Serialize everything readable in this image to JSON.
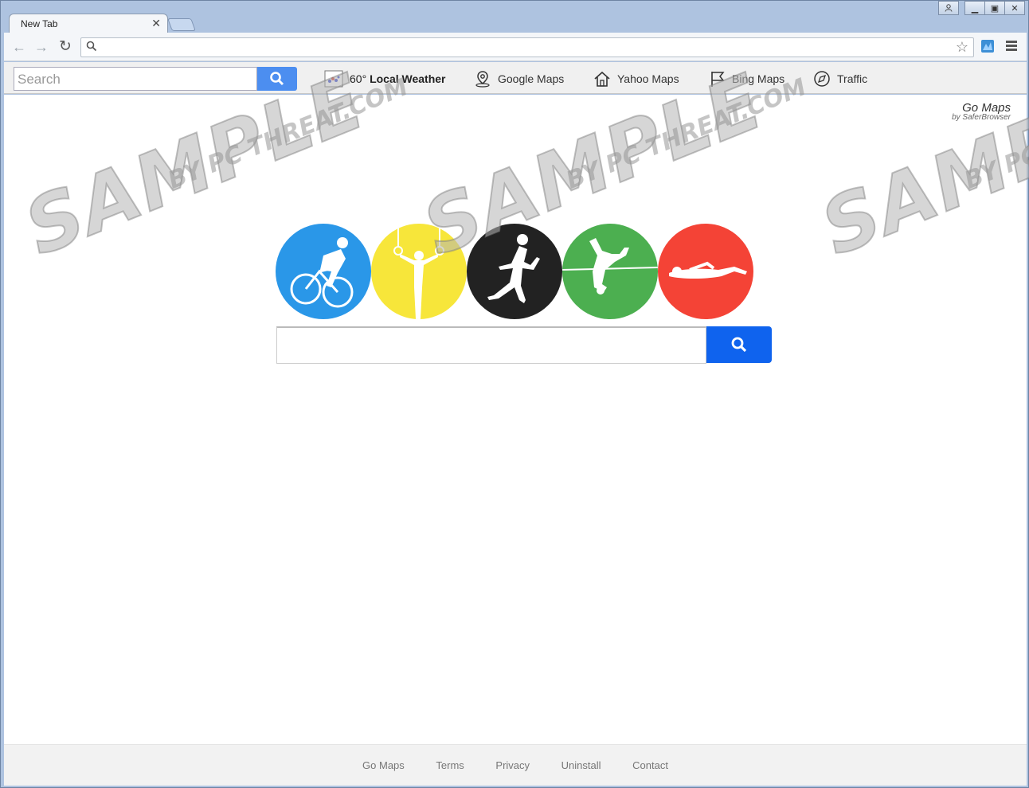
{
  "tab": {
    "title": "New Tab"
  },
  "omnibox": {
    "value": ""
  },
  "extension_bar": {
    "search_placeholder": "Search",
    "weather_temp": "60°",
    "weather_label": "Local Weather",
    "links": [
      {
        "label": "Google Maps",
        "icon": "map-pin-icon"
      },
      {
        "label": "Yahoo Maps",
        "icon": "home-icon"
      },
      {
        "label": "Bing Maps",
        "icon": "flag-icon"
      },
      {
        "label": "Traffic",
        "icon": "compass-icon"
      }
    ]
  },
  "brand": {
    "name": "Go Maps",
    "sub": "by SaferBrowser"
  },
  "sports_rings": [
    {
      "sport": "cycling",
      "color": "#2a97e8"
    },
    {
      "sport": "gymnastics",
      "color": "#f7e63a"
    },
    {
      "sport": "running",
      "color": "#222222"
    },
    {
      "sport": "high-jump",
      "color": "#4caf50"
    },
    {
      "sport": "swimming",
      "color": "#f44336"
    }
  ],
  "main_search": {
    "value": ""
  },
  "footer": {
    "links": [
      "Go Maps",
      "Terms",
      "Privacy",
      "Uninstall",
      "Contact"
    ]
  },
  "watermark": {
    "big": "SAMPLE",
    "small": "BY PC THREAT.COM"
  }
}
